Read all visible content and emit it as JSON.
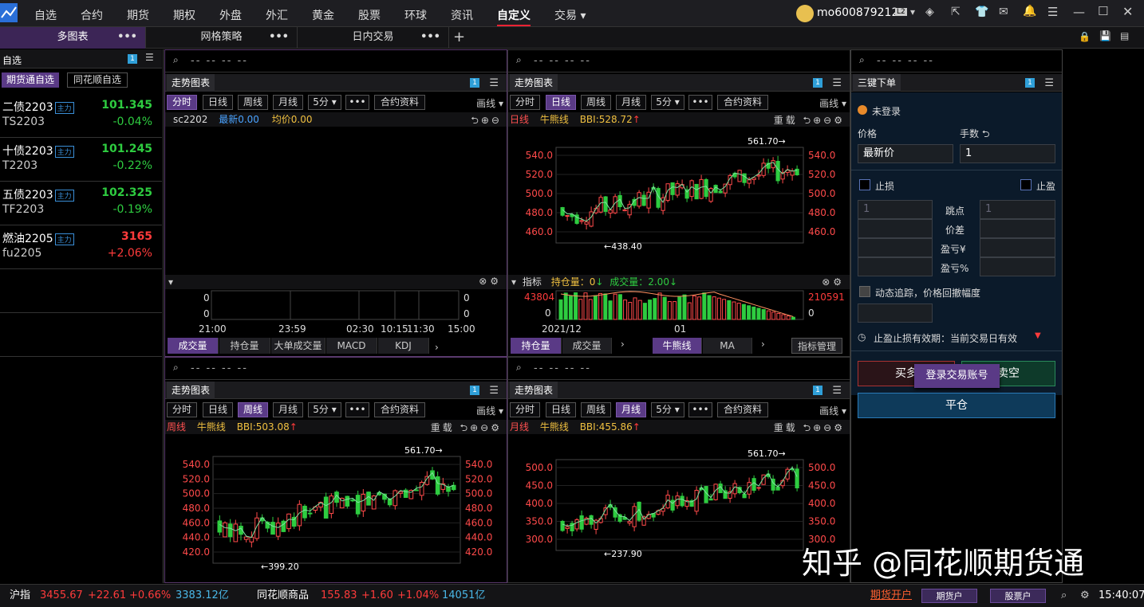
{
  "nav": {
    "items": [
      "自选",
      "合约",
      "期货",
      "期权",
      "外盘",
      "外汇",
      "黄金",
      "股票",
      "环球",
      "资讯",
      "自定义",
      "交易"
    ],
    "active": "自定义",
    "username": "mo600879212",
    "level": "L2"
  },
  "tabs": [
    {
      "label": "多图表"
    },
    {
      "label": "网格策略"
    },
    {
      "label": "日内交易"
    }
  ],
  "tab_more": "•••",
  "add_tab": "+",
  "left": {
    "title": "自选",
    "badge": "1",
    "btn1": "期货通自选",
    "btn2": "同花顺自选",
    "items": [
      {
        "name": "二债2203",
        "code": "TS2203",
        "price": "101.345",
        "change": "-0.04%",
        "tag": "主力"
      },
      {
        "name": "十债2203",
        "code": "T2203",
        "price": "101.245",
        "change": "-0.22%",
        "tag": "主力"
      },
      {
        "name": "五债2203",
        "code": "TF2203",
        "price": "102.325",
        "change": "-0.19%",
        "tag": "主力"
      },
      {
        "name": "燃油2205",
        "code": "fu2205",
        "price": "3165",
        "change": "+2.06%",
        "tag": "主力"
      }
    ]
  },
  "search_placeholder": "-- -- -- --",
  "chart_title": "走势图表",
  "toolbar": {
    "fenshi": "分时",
    "rixian": "日线",
    "zhouxian": "周线",
    "yuexian": "月线",
    "min5": "5分 ▾",
    "more": "•••",
    "contract": "合约资料",
    "draw": "画线 ▾"
  },
  "panel1": {
    "code": "sc2202",
    "latest": "最新0.00",
    "avg": "均价0.00",
    "vol_left": [
      "0",
      "0"
    ],
    "vol_right": [
      "0",
      "0"
    ],
    "times": [
      "21:00",
      "23:59",
      "02:30",
      "10:15",
      "11:30",
      "15:00"
    ],
    "tabs": [
      "成交量",
      "持仓量",
      "大单成交量",
      "MACD",
      "KDJ"
    ]
  },
  "panel2": {
    "period": "日线",
    "ind": "牛熊线",
    "bbi": "BBI:528.72",
    "reload": "重载",
    "yaxis": [
      "540.0",
      "520.0",
      "500.0",
      "480.0",
      "460.0"
    ],
    "yaxis_r": [
      "540.0",
      "520.0",
      "500.0",
      "480.0",
      "460.0"
    ],
    "high": "561.70→",
    "low": "←438.40",
    "indname": "指标",
    "oi": "持仓量：0",
    "vol": "成交量：2.00",
    "sub_l": "43804",
    "sub_l0": "0",
    "sub_r": "210591",
    "sub_r0": "0",
    "xlab": [
      "2021/12",
      "01"
    ],
    "tabs": [
      "持仓量",
      "成交量",
      "牛熊线",
      "MA"
    ],
    "mgr": "指标管理"
  },
  "panel3": {
    "period": "周线",
    "ind": "牛熊线",
    "bbi": "BBI:503.08",
    "reload": "重载",
    "yaxis": [
      "540.0",
      "520.0",
      "500.0",
      "480.0",
      "460.0",
      "440.0",
      "420.0"
    ],
    "high": "561.70→",
    "low": "←399.20"
  },
  "panel4": {
    "period": "月线",
    "ind": "牛熊线",
    "bbi": "BBI:455.86",
    "reload": "重载",
    "yaxis": [
      "500.0",
      "450.0",
      "400.0",
      "350.0",
      "300.0"
    ],
    "high": "561.70→",
    "low": "←237.90"
  },
  "right": {
    "title": "三键下单",
    "badge": "1",
    "login": "未登录",
    "price_label": "价格",
    "qty_label": "手数 ⮌",
    "price_val": "最新价",
    "qty_val": "1",
    "stoploss": "止损",
    "stopprofit": "止盈",
    "sl_val": "1",
    "sp_val": "1",
    "labels": [
      "跳点",
      "价差",
      "盈亏¥",
      "盈亏%"
    ],
    "trail": "动态追踪，价格回撤幅度",
    "validity": "止盈止损有效期：当前交易日有效",
    "buy": "买多",
    "sell": "卖空",
    "close": "平仓",
    "tooltip": "登录交易账号"
  },
  "status": {
    "idx_name": "沪指",
    "idx_val": "3455.67",
    "idx_chg": "+22.61",
    "idx_pct": "+0.66%",
    "idx_amt": "3383.12亿",
    "c_name": "同花顺商品",
    "c_val": "155.83",
    "c_chg": "+1.60",
    "c_pct": "+1.04%",
    "c_amt": "14051亿",
    "open": "期货开户",
    "b1": "期货户",
    "b2": "股票户",
    "time": "15:40:07"
  },
  "watermark": "知乎 @同花顺期货通",
  "colors": {
    "up": "#ff3b3b",
    "down": "#2ecc40",
    "accent": "#5a3a86"
  }
}
